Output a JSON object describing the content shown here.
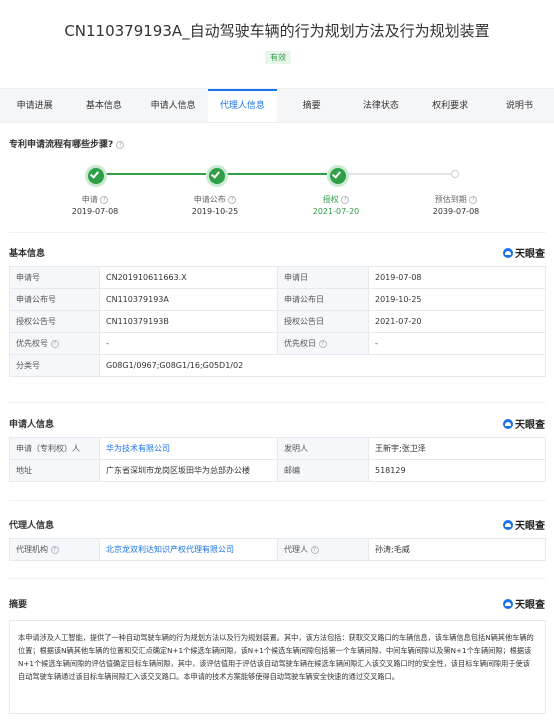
{
  "header": {
    "title": "CN110379193A_自动驾驶车辆的行为规划方法及行为规划装置",
    "status_badge": "有效"
  },
  "tabs": [
    {
      "label": "申请进展"
    },
    {
      "label": "基本信息"
    },
    {
      "label": "申请人信息"
    },
    {
      "label": "代理人信息",
      "active": true
    },
    {
      "label": "摘要"
    },
    {
      "label": "法律状态"
    },
    {
      "label": "权利要求"
    },
    {
      "label": "说明书"
    }
  ],
  "flow": {
    "question": "专利申请流程有哪些步骤?",
    "steps": [
      {
        "label": "申请",
        "date": "2019-07-08",
        "done": true
      },
      {
        "label": "申请公布",
        "date": "2019-10-25",
        "done": true
      },
      {
        "label": "授权",
        "date": "2021-07-20",
        "done": true,
        "current": true
      },
      {
        "label": "预估到期",
        "date": "2039-07-08",
        "done": false
      }
    ]
  },
  "brand": "天眼查",
  "basic": {
    "title": "基本信息",
    "app_no_label": "申请号",
    "app_no": "CN201910611663.X",
    "app_date_label": "申请日",
    "app_date": "2019-07-08",
    "pub_no_label": "申请公布号",
    "pub_no": "CN110379193A",
    "pub_date_label": "申请公布日",
    "pub_date": "2019-10-25",
    "grant_no_label": "授权公告号",
    "grant_no": "CN110379193B",
    "grant_date_label": "授权公告日",
    "grant_date": "2021-07-20",
    "priority_no_label": "优先权号",
    "priority_no": "-",
    "priority_date_label": "优先权日",
    "priority_date": "-",
    "class_label": "分类号",
    "class_value": "G08G1/0967;G08G1/16;G05D1/02"
  },
  "applicant": {
    "title": "申请人信息",
    "owner_label": "申请（专利权）人",
    "owner": "华为技术有限公司",
    "inventor_label": "发明人",
    "inventor": "王新宇;张卫泽",
    "address_label": "地址",
    "address": "广东省深圳市龙岗区坂田华为总部办公楼",
    "zip_label": "邮编",
    "zip": "518129"
  },
  "agent": {
    "title": "代理人信息",
    "org_label": "代理机构",
    "org": "北京龙双利达知识产权代理有限公司",
    "person_label": "代理人",
    "person": "孙涛;毛威"
  },
  "abstract": {
    "title": "摘要",
    "text": "本申请涉及人工智能，提供了一种自动驾驶车辆的行为规划方法以及行为规划装置。其中，该方法包括：获取交叉路口的车辆信息，该车辆信息包括N辆其他车辆的位置；根据该N辆其他车辆的位置和交汇点确定N+1个候选车辆间隙，该N+1个候选车辆间隙包括第一个车辆间隙、中间车辆间隙以及第N+1个车辆间隙；根据该N+1个候选车辆间隙的评估值确定目标车辆间隙，其中，该评估值用于评估该自动驾驶车辆在候选车辆间隙汇入该交叉路口时的安全性，该目标车辆间隙用于使该自动驾驶车辆通过该目标车辆间隙汇入该交叉路口。本申请的技术方案能够使得自动驾驶车辆安全快速的通过交叉路口。"
  }
}
